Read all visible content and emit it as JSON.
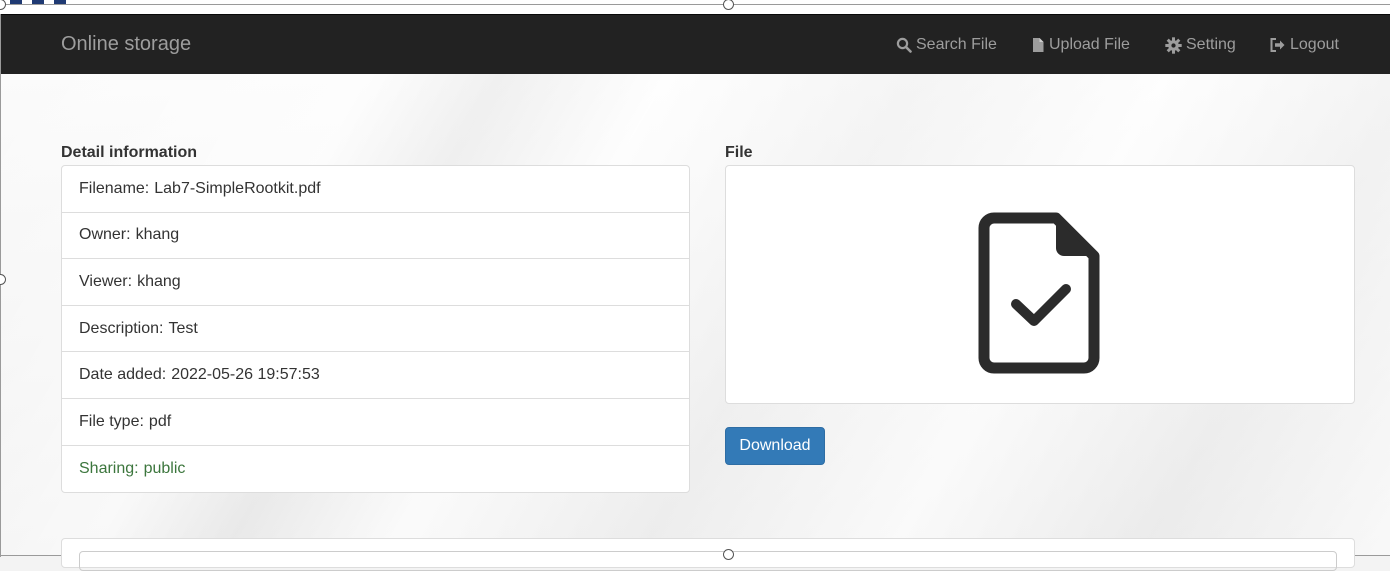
{
  "navbar": {
    "brand": "Online storage",
    "items": [
      {
        "label": "Search File",
        "icon": "search-icon"
      },
      {
        "label": "Upload File",
        "icon": "file-icon"
      },
      {
        "label": "Setting",
        "icon": "gear-icon"
      },
      {
        "label": "Logout",
        "icon": "logout-icon"
      }
    ]
  },
  "detail": {
    "heading": "Detail information",
    "items": [
      {
        "label": "Filename:",
        "value": "Lab7-SimpleRootkit.pdf"
      },
      {
        "label": "Owner:",
        "value": "khang"
      },
      {
        "label": "Viewer:",
        "value": "khang"
      },
      {
        "label": "Description:",
        "value": "Test"
      },
      {
        "label": "Date added:",
        "value": "2022-05-26 19:57:53"
      },
      {
        "label": "File type:",
        "value": "pdf"
      },
      {
        "label": "Sharing:",
        "value": "public"
      }
    ]
  },
  "file": {
    "heading": "File",
    "preview_icon": "file-check-icon",
    "download_label": "Download"
  },
  "colors": {
    "navbar_bg": "#222222",
    "navbar_text": "#9d9d9d",
    "primary": "#337ab7",
    "success_text": "#3c763d"
  }
}
